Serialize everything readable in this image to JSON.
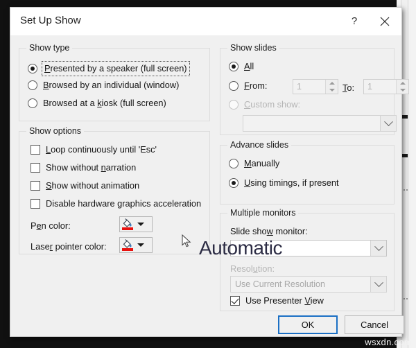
{
  "window": {
    "title": "Set Up Show",
    "help_icon": "question-mark-icon",
    "help_label": "?",
    "close_icon": "close-icon"
  },
  "show_type": {
    "legend": "Show type",
    "options": [
      {
        "label": "Presented by a speaker (full screen)",
        "accel": "P",
        "selected": true,
        "focused": true
      },
      {
        "label": "Browsed by an individual (window)",
        "accel": "B",
        "selected": false,
        "focused": false
      },
      {
        "label": "Browsed at a kiosk (full screen)",
        "accel": "k",
        "selected": false,
        "focused": false
      }
    ]
  },
  "show_options": {
    "legend": "Show options",
    "checkboxes": [
      {
        "label": "Loop continuously until 'Esc'",
        "accel": "L",
        "checked": false
      },
      {
        "label": "Show without narration",
        "accel": "n",
        "checked": false
      },
      {
        "label": "Show without animation",
        "accel": "S",
        "checked": false
      },
      {
        "label": "Disable hardware graphics acceleration",
        "accel": "g",
        "checked": false
      }
    ],
    "pen_color_label": "Pen color:",
    "pen_color_accel": "e",
    "laser_color_label": "Laser pointer color:",
    "laser_color_accel": "r",
    "color_swatch_hex": "#e8120f",
    "color_icon": "paint-bucket-icon"
  },
  "show_slides": {
    "legend": "Show slides",
    "all_label": "All",
    "all_accel": "A",
    "all_selected": true,
    "from_label": "From:",
    "from_accel": "F",
    "from_value": "1",
    "from_selected": false,
    "to_label": "To:",
    "to_accel": "T",
    "to_value": "1",
    "custom_label": "Custom show:",
    "custom_accel": "C",
    "custom_selected": false,
    "custom_disabled": true,
    "custom_value": ""
  },
  "advance_slides": {
    "legend": "Advance slides",
    "options": [
      {
        "label": "Manually",
        "accel": "M",
        "selected": false
      },
      {
        "label": "Using timings, if present",
        "accel": "U",
        "selected": true
      }
    ]
  },
  "multiple_monitors": {
    "legend": "Multiple monitors",
    "monitor_label": "Slide show monitor:",
    "monitor_accel": "w",
    "monitor_value": "Automatic",
    "resolution_label": "Resolution:",
    "resolution_accel": "u",
    "resolution_value": "Use Current Resolution",
    "resolution_disabled": true,
    "presenter_view_label": "Use Presenter View",
    "presenter_view_accel": "V",
    "presenter_view_checked": true
  },
  "footer": {
    "ok_label": "OK",
    "cancel_label": "Cancel"
  },
  "watermark": "wsxdn.com"
}
